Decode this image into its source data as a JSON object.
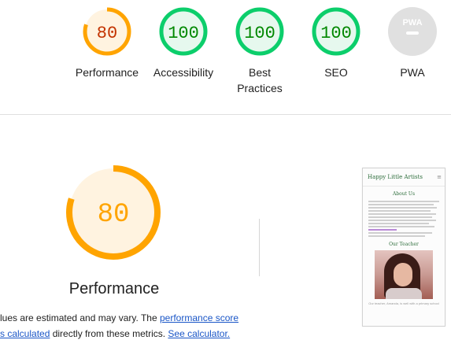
{
  "categories": [
    {
      "key": "performance",
      "label": "Performance",
      "score": "80",
      "value": 0.8,
      "status": "average",
      "color": "#ffa400",
      "fill": "#fff3e0",
      "text_color": "#c33300"
    },
    {
      "key": "accessibility",
      "label": "Accessibility",
      "score": "100",
      "value": 1.0,
      "status": "pass",
      "color": "#0cce6b",
      "fill": "#e6f8ee",
      "text_color": "#008800"
    },
    {
      "key": "best_practices",
      "label_line1": "Best",
      "label_line2": "Practices",
      "score": "100",
      "value": 1.0,
      "status": "pass",
      "color": "#0cce6b",
      "fill": "#e6f8ee",
      "text_color": "#008800"
    },
    {
      "key": "seo",
      "label": "SEO",
      "score": "100",
      "value": 1.0,
      "status": "pass",
      "color": "#0cce6b",
      "fill": "#e6f8ee",
      "text_color": "#008800"
    },
    {
      "key": "pwa",
      "label": "PWA",
      "badge_text": "PWA",
      "value": 0,
      "status": "na",
      "color": "#cccccc",
      "fill": "#e0e0e0",
      "text_color": "#ffffff"
    }
  ],
  "main": {
    "title": "Performance",
    "score": "80",
    "value": 0.8,
    "color": "#ffa400",
    "fill": "#fff3e0",
    "score_color": "#ffa400"
  },
  "description": {
    "line1_text": "lues are estimated and may vary. The ",
    "line1_link": "performance score",
    "line2_link1": "s calculated",
    "line2_text": " directly from these metrics. ",
    "line2_link2": "See calculator."
  },
  "screenshot": {
    "site_title": "Happy Little Artists",
    "menu_icon": "≡",
    "section1": "About Us",
    "section2": "Our Teacher",
    "caption": "Our teacher, Amanda, is well with a primary school"
  }
}
